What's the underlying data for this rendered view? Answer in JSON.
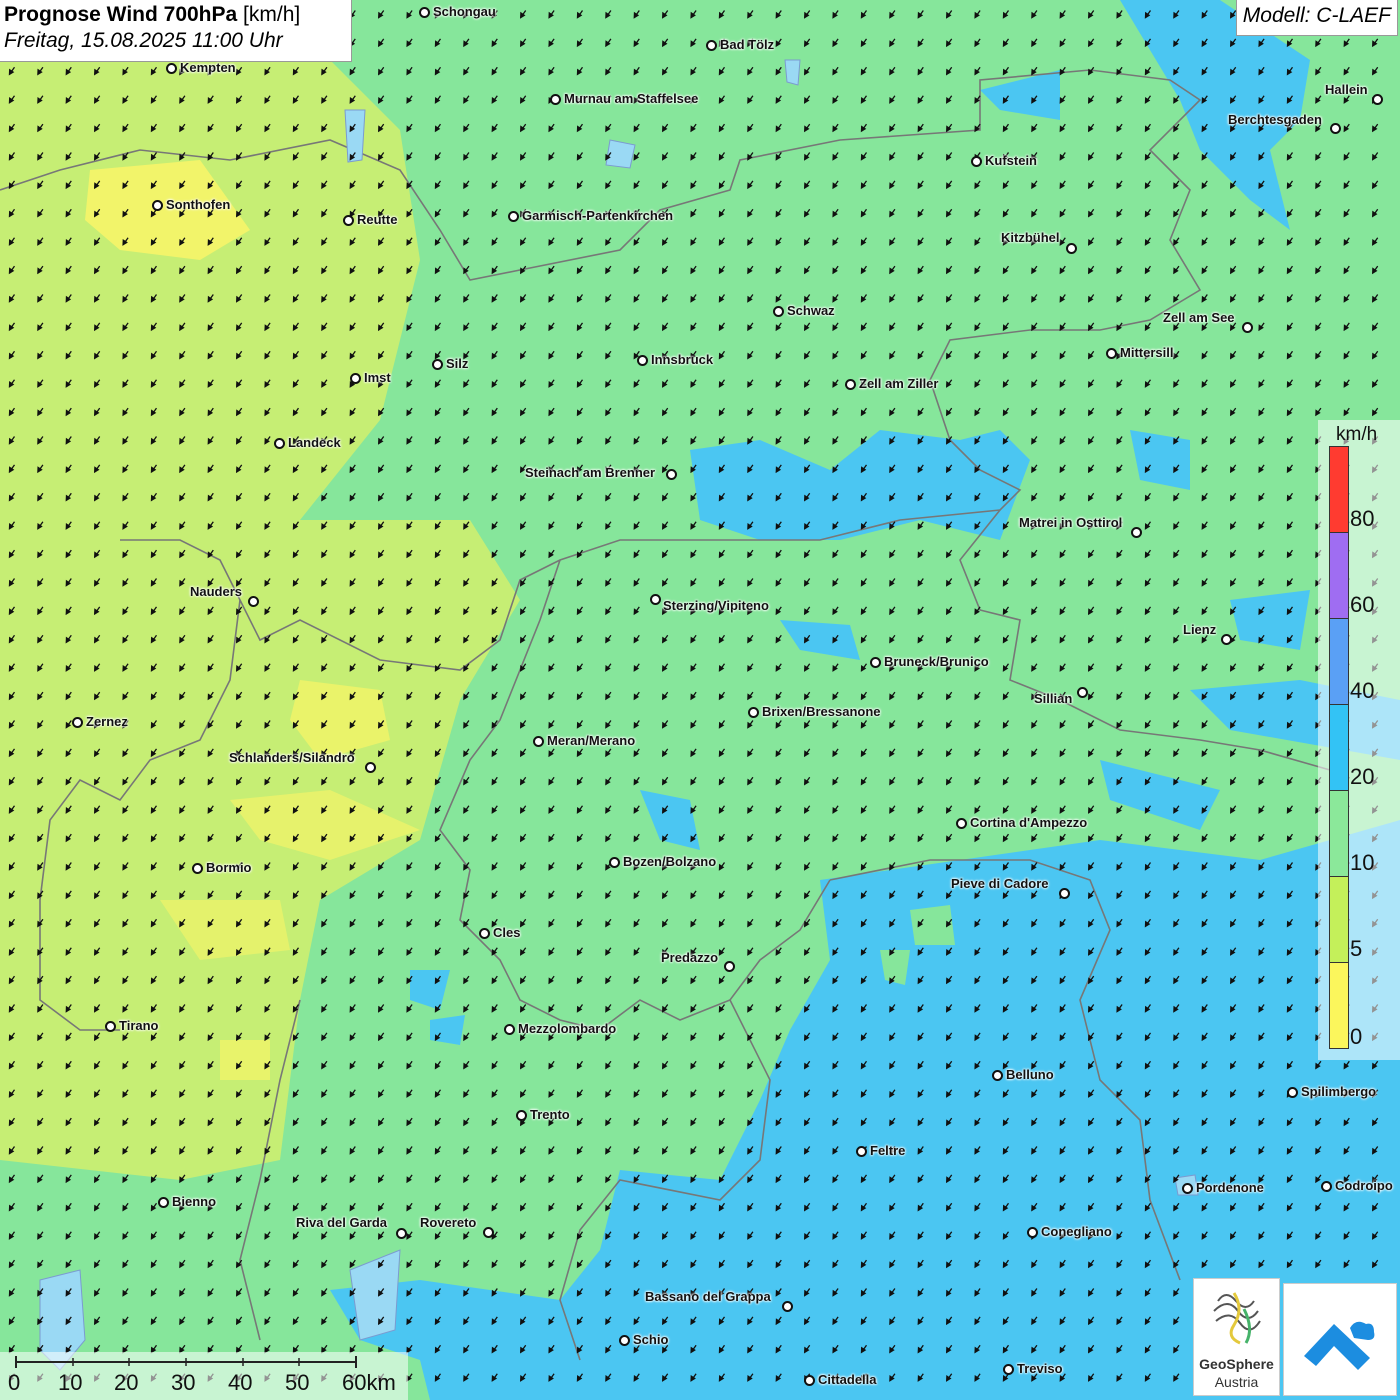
{
  "header": {
    "title_bold": "Prognose Wind 700hPa",
    "title_unit": " [km/h]",
    "subtitle": "Freitag, 15.08.2025 11:00 Uhr",
    "model": "Modell: C-LAEF"
  },
  "legend": {
    "unit": "km/h",
    "bands": [
      {
        "color": "#ff3b30"
      },
      {
        "color": "#9f6df2"
      },
      {
        "color": "#5aa0f5"
      },
      {
        "color": "#33c3f5"
      },
      {
        "color": "#8be89a"
      },
      {
        "color": "#c4f05a"
      },
      {
        "color": "#fbf65c"
      }
    ],
    "labels": [
      "80",
      "60",
      "40",
      "20",
      "10",
      "5",
      "0"
    ]
  },
  "scale": {
    "labels": [
      "0",
      "10",
      "20",
      "30",
      "40",
      "50",
      "60km"
    ]
  },
  "logo": {
    "name_line1": "GeoSphere",
    "name_line2": "Austria"
  },
  "cities": [
    {
      "name": "Schongau"
    },
    {
      "name": "Bad Tölz"
    },
    {
      "name": "Kempten"
    },
    {
      "name": "Murnau am Staffelsee"
    },
    {
      "name": "Hallein"
    },
    {
      "name": "Berchtesgaden"
    },
    {
      "name": "Kufstein"
    },
    {
      "name": "Sonthofen"
    },
    {
      "name": "Reutte"
    },
    {
      "name": "Garmisch-Partenkirchen"
    },
    {
      "name": "Kitzbühel"
    },
    {
      "name": "Schwaz"
    },
    {
      "name": "Zell am See"
    },
    {
      "name": "Mittersill"
    },
    {
      "name": "Silz"
    },
    {
      "name": "Innsbruck"
    },
    {
      "name": "Imst"
    },
    {
      "name": "Zell am Ziller"
    },
    {
      "name": "Landeck"
    },
    {
      "name": "Steinach am Brenner"
    },
    {
      "name": "Matrei in Osttirol"
    },
    {
      "name": "Nauders"
    },
    {
      "name": "Sterzing/Vipiteno"
    },
    {
      "name": "Lienz"
    },
    {
      "name": "Bruneck/Brunico"
    },
    {
      "name": "Sillian"
    },
    {
      "name": "Zernez"
    },
    {
      "name": "Brixen/Bressanone"
    },
    {
      "name": "Meran/Merano"
    },
    {
      "name": "Schlanders/Silandro"
    },
    {
      "name": "Cortina d'Ampezzo"
    },
    {
      "name": "Bozen/Bolzano"
    },
    {
      "name": "Bormio"
    },
    {
      "name": "Pieve di Cadore"
    },
    {
      "name": "Cles"
    },
    {
      "name": "Predazzo"
    },
    {
      "name": "Tirano"
    },
    {
      "name": "Mezzolombardo"
    },
    {
      "name": "Belluno"
    },
    {
      "name": "Spilimbergo"
    },
    {
      "name": "Trento"
    },
    {
      "name": "Feltre"
    },
    {
      "name": "Pordenone"
    },
    {
      "name": "Codroipo"
    },
    {
      "name": "Bienno"
    },
    {
      "name": "Riva del Garda"
    },
    {
      "name": "Rovereto"
    },
    {
      "name": "Conegliano"
    },
    {
      "name": "Bassano del Grappa"
    },
    {
      "name": "Schio"
    },
    {
      "name": "Treviso"
    },
    {
      "name": "Cittadella"
    }
  ]
}
